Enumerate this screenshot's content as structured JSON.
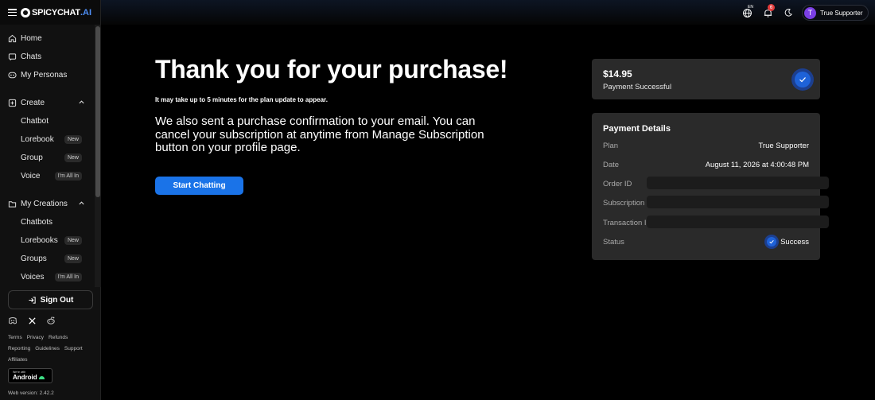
{
  "brand": {
    "name": "SPICYCHAT",
    "suffix": ".AI"
  },
  "sidebar": {
    "top_items": [
      {
        "label": "Home",
        "icon": "home-icon"
      },
      {
        "label": "Chats",
        "icon": "chat-icon"
      },
      {
        "label": "My Personas",
        "icon": "persona-icon"
      }
    ],
    "create": {
      "label": "Create",
      "items": [
        {
          "label": "Chatbot",
          "badge": ""
        },
        {
          "label": "Lorebook",
          "badge": "New"
        },
        {
          "label": "Group",
          "badge": "New"
        },
        {
          "label": "Voice",
          "badge": "I'm All In"
        }
      ]
    },
    "creations": {
      "label": "My Creations",
      "items": [
        {
          "label": "Chatbots",
          "badge": ""
        },
        {
          "label": "Lorebooks",
          "badge": "New"
        },
        {
          "label": "Groups",
          "badge": "New"
        },
        {
          "label": "Voices",
          "badge": "I'm All In"
        }
      ]
    },
    "sign_out": "Sign Out",
    "footer_links": [
      "Terms",
      "Privacy",
      "Refunds",
      "Reporting",
      "Guidelines",
      "Support",
      "Affiliates"
    ],
    "android": {
      "small": "We're with",
      "big": "Android"
    },
    "version": "Web version: 2.42.2"
  },
  "topbar": {
    "language": "EN",
    "notifications": "6",
    "user_initial": "T",
    "user_name": "True Supporter"
  },
  "main": {
    "title": "Thank you for your purchase!",
    "note": "It may take up to 5 minutes for the plan update to appear.",
    "body": "We also sent a purchase confirmation to your email. You can cancel your subscription at anytime from Manage Subscription button on your profile page.",
    "start_button": "Start Chatting"
  },
  "payment": {
    "amount": "$14.95",
    "status": "Payment Successful"
  },
  "details": {
    "title": "Payment Details",
    "plan_label": "Plan",
    "plan_value": "True Supporter",
    "date_label": "Date",
    "date_value": "August 11, 2026 at 4:00:48 PM",
    "order_label": "Order ID",
    "subscription_label": "Subscription ID",
    "transaction_label": "Transaction ID",
    "status_label": "Status",
    "status_value": "Success"
  },
  "colors": {
    "accent": "#1a73e8",
    "badge_red": "#e23b3b",
    "avatar": "#7b3fe4"
  }
}
